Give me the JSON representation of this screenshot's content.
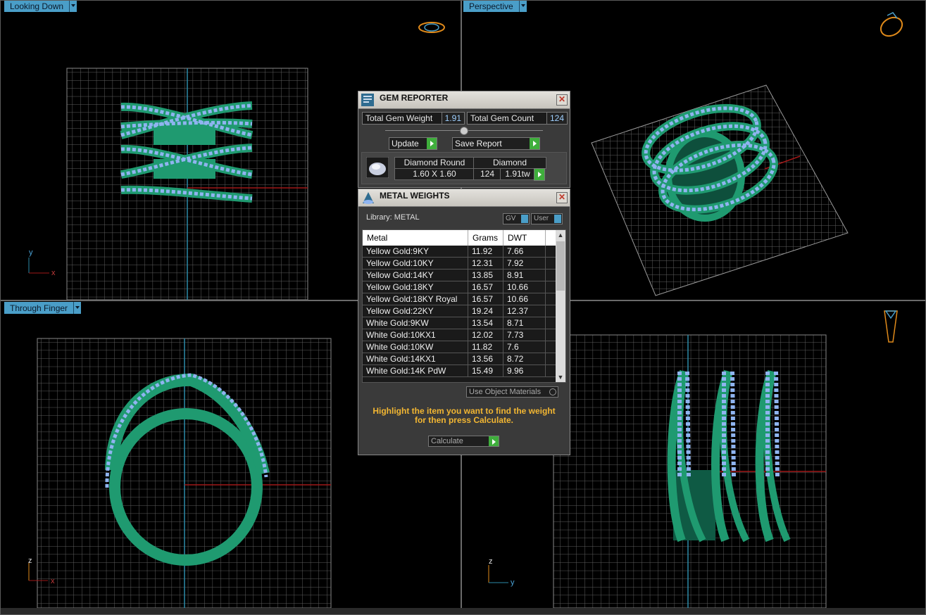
{
  "viewports": {
    "top_left": {
      "label": "Looking Down",
      "axis_a": "y",
      "axis_b": "x"
    },
    "top_right": {
      "label": "Perspective"
    },
    "bottom_left": {
      "label": "Through Finger",
      "axis_a": "z",
      "axis_b": "x"
    },
    "bottom_right": {
      "axis_a": "z",
      "axis_b": "y"
    }
  },
  "gem_reporter": {
    "title": "GEM REPORTER",
    "total_gem_weight_label": "Total Gem Weight",
    "total_gem_weight": "1.91",
    "total_gem_count_label": "Total Gem Count",
    "total_gem_count": "124",
    "update_label": "Update",
    "save_report_label": "Save Report",
    "gem": {
      "shape": "Diamond Round",
      "size": "1.60 X 1.60",
      "material": "Diamond",
      "count": "124",
      "weight": "1.91tw"
    }
  },
  "metal_weights": {
    "title": "METAL WEIGHTS",
    "library_label": "Library:  METAL",
    "gv_label": "GV",
    "user_label": "User",
    "columns": [
      "Metal",
      "Grams",
      "DWT"
    ],
    "rows": [
      [
        "Yellow Gold:9KY",
        "11.92",
        "7.66"
      ],
      [
        "Yellow Gold:10KY",
        "12.31",
        "7.92"
      ],
      [
        "Yellow Gold:14KY",
        "13.85",
        "8.91"
      ],
      [
        "Yellow Gold:18KY",
        "16.57",
        "10.66"
      ],
      [
        "Yellow Gold:18KY Royal",
        "16.57",
        "10.66"
      ],
      [
        "Yellow Gold:22KY",
        "19.24",
        "12.37"
      ],
      [
        "White Gold:9KW",
        "13.54",
        "8.71"
      ],
      [
        "White Gold:10KX1",
        "12.02",
        "7.73"
      ],
      [
        "White Gold:10KW",
        "11.82",
        "7.6"
      ],
      [
        "White Gold:14KX1",
        "13.56",
        "8.72"
      ],
      [
        "White Gold:14K PdW",
        "15.49",
        "9.96"
      ]
    ],
    "use_object_materials_label": "Use Object Materials",
    "hint_line1": "Highlight the item you want to find the weight",
    "hint_line2": "for then press Calculate.",
    "calculate_label": "Calculate"
  },
  "colors": {
    "ring_green": "#1f8f6a",
    "gem_blue": "#8fb4f0",
    "grid": "#6c6c6c",
    "accent_label": "#4a9ec8",
    "hint": "#f2b632"
  }
}
